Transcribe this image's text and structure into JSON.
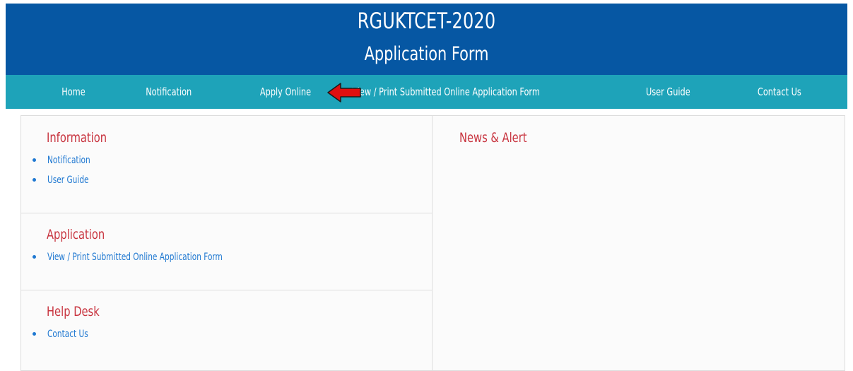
{
  "header": {
    "title": "RGUKTCET-2020",
    "subtitle": "Application Form"
  },
  "nav": {
    "items": [
      {
        "label": "Home"
      },
      {
        "label": "Notification"
      },
      {
        "label": "Apply Online"
      },
      {
        "label": "View / Print Submitted Online Application Form"
      },
      {
        "label": "User Guide"
      },
      {
        "label": "Contact Us"
      }
    ],
    "highlight_icon": "left-arrow-icon"
  },
  "sections": {
    "information": {
      "title": "Information",
      "links": [
        {
          "label": "Notification"
        },
        {
          "label": "User Guide"
        }
      ]
    },
    "application": {
      "title": "Application",
      "links": [
        {
          "label": "View / Print Submitted Online Application Form"
        }
      ]
    },
    "help_desk": {
      "title": "Help Desk",
      "links": [
        {
          "label": "Contact Us"
        }
      ]
    }
  },
  "news": {
    "title": "News & Alert"
  },
  "colors": {
    "header_bg": "#0657a3",
    "nav_bg": "#1ea3b9",
    "section_title": "#c8343f",
    "link": "#1f78d1",
    "arrow": "#e01010"
  }
}
